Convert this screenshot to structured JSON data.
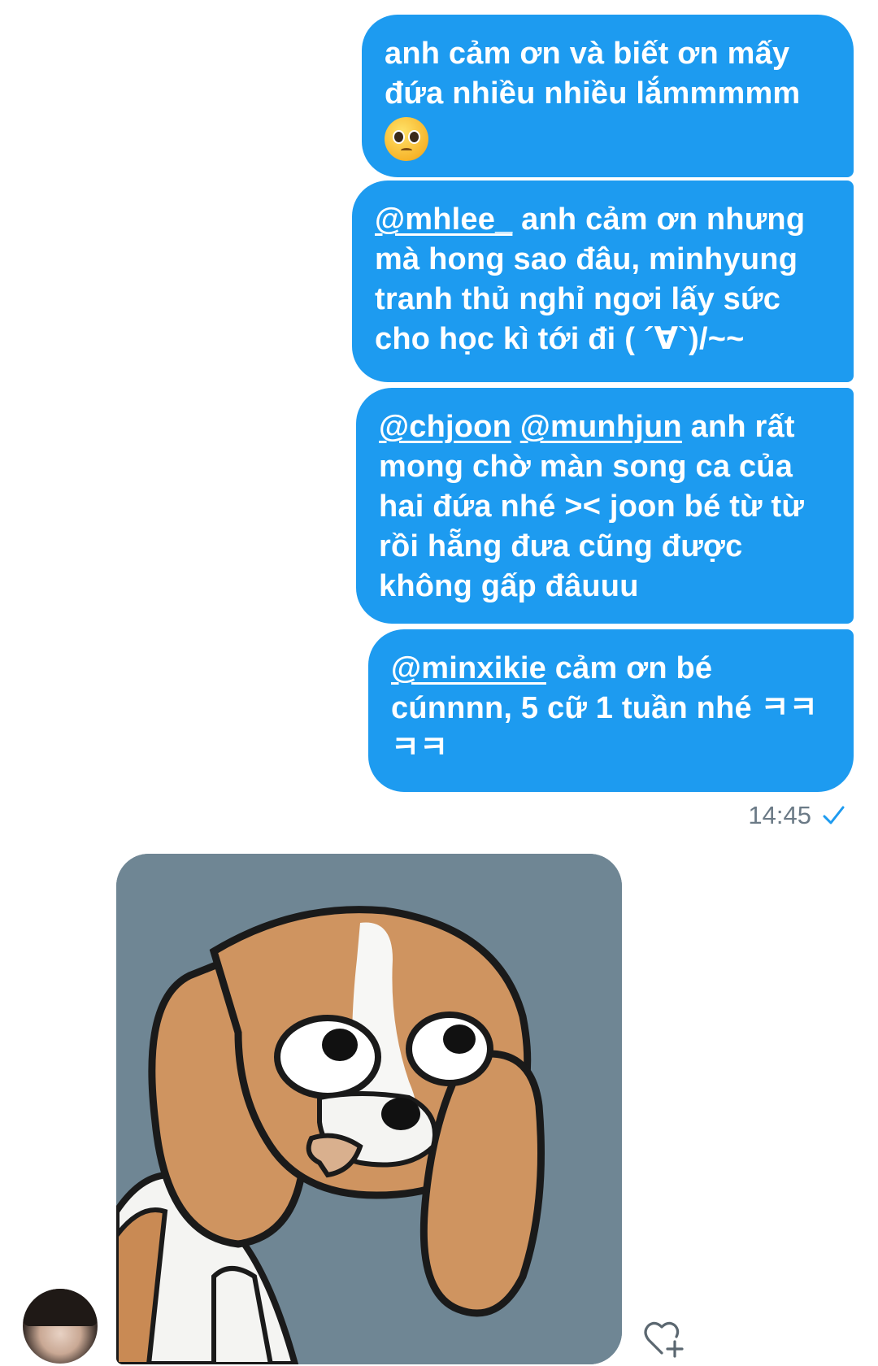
{
  "messages": [
    {
      "parts": [
        {
          "text": "anh cảm ơn và biết ơn mấy đứa nhiều nhiều lắmmmmm"
        }
      ],
      "emoji": "pleading-face-icon"
    },
    {
      "parts": [
        {
          "mention": "@mhlee_"
        },
        {
          "text": " anh cảm ơn nhưng mà hong sao đâu, minhyung tranh thủ nghỉ ngơi lấy sức cho học kì tới đi ( ´∀`)/~~"
        }
      ]
    },
    {
      "parts": [
        {
          "mention": "@chjoon"
        },
        {
          "text": " "
        },
        {
          "mention": "@munhjun"
        },
        {
          "text": " anh rất mong chờ màn song ca của hai đứa nhé >< joon bé từ từ rồi hẵng đưa cũng được không gấp đâuuu"
        }
      ]
    },
    {
      "parts": [
        {
          "mention": "@minxikie"
        },
        {
          "text": " cảm ơn bé cúnnnn, 5 cữ 1 tuần nhé ㅋㅋㅋㅋ"
        }
      ]
    }
  ],
  "status": {
    "time": "14:45",
    "icon": "sent-check-icon",
    "check_color": "#1D9BF0"
  },
  "received": {
    "media": "beagle-sticker",
    "icons": [
      "avatar",
      "heart-plus-icon"
    ]
  },
  "colors": {
    "bubble": "#1D9BF0",
    "media_bg": "#6f8694",
    "timestamp": "#6b7a86"
  }
}
